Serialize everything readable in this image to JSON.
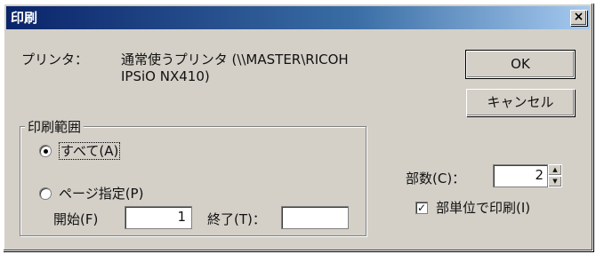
{
  "window": {
    "title": "印刷",
    "close_glyph": "×"
  },
  "printer": {
    "label": "プリンタ：",
    "value_line1": "通常使うプリンタ (\\\\MASTER\\RICOH",
    "value_line2": "IPSiO NX410)"
  },
  "buttons": {
    "ok": "OK",
    "cancel": "キャンセル"
  },
  "range": {
    "group_label": "印刷範囲",
    "all_label": "すべて(A)",
    "page_label": "ページ指定(P)",
    "start_label": "開始(F)",
    "start_value": "1",
    "end_label": "終了(T)：",
    "end_value": "",
    "selected": "all"
  },
  "copies": {
    "label": "部数(C)：",
    "value": "2",
    "collate_label": "部単位で印刷(I)",
    "collate_checked": true
  }
}
